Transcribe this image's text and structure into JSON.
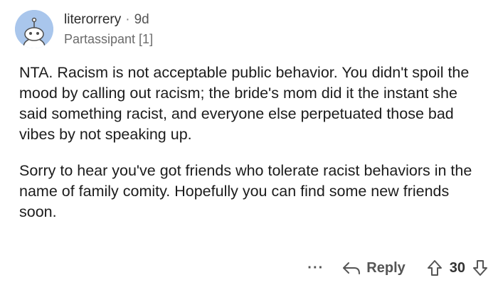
{
  "comment": {
    "username": "literorrery",
    "separator": "·",
    "age": "9d",
    "flair": "Partassipant [1]",
    "paragraphs": [
      "NTA. Racism is not acceptable public behavior. You didn't spoil the mood by calling out racism; the bride's mom did it the instant she said something racist, and everyone else perpetuated those bad vibes by not speaking up.",
      "Sorry to hear you've got friends who tolerate racist behaviors in the name of family comity. Hopefully you can find some new friends soon."
    ]
  },
  "actions": {
    "more_label": "···",
    "reply_label": "Reply",
    "vote_count": "30",
    "icons": [
      "avatar-icon",
      "reply-icon",
      "upvote-icon",
      "downvote-icon"
    ]
  }
}
